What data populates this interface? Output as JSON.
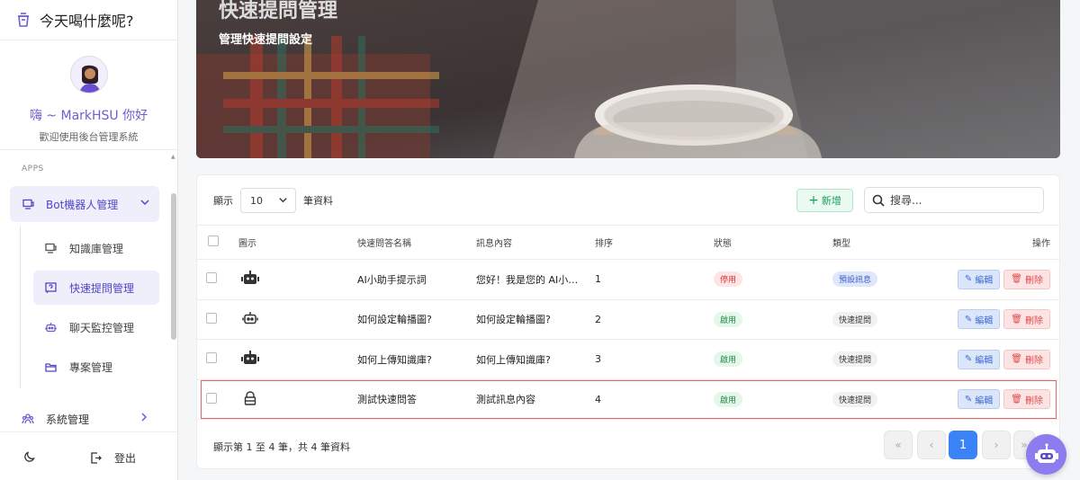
{
  "app": {
    "title": "今天喝什麼呢?"
  },
  "profile": {
    "greeting": "嗨 ~ MarkHSU 你好",
    "welcome": "歡迎使用後台管理系統"
  },
  "sidebar": {
    "section_label": "APPS",
    "group_label": "Bot機器人管理",
    "items": [
      {
        "label": "知識庫管理"
      },
      {
        "label": "快速提問管理"
      },
      {
        "label": "聊天監控管理"
      },
      {
        "label": "專案管理"
      }
    ],
    "system_label": "系統管理",
    "logout_label": "登出"
  },
  "banner": {
    "title": "快速提問管理",
    "subtitle": "管理快速提問設定"
  },
  "toolbar": {
    "show_label": "顯示",
    "page_size": "10",
    "records_label": "筆資料",
    "add_label": "新增",
    "search_placeholder": "搜尋..."
  },
  "table": {
    "headers": [
      "圖示",
      "快速問答名稱",
      "訊息內容",
      "排序",
      "狀態",
      "類型",
      "操作"
    ],
    "rows": [
      {
        "icon": "robot-icon",
        "name": "AI小助手提示詞",
        "message": "您好！我是您的 AI小…",
        "order": "1",
        "status": "停用",
        "status_color": "red",
        "type": "預設訊息",
        "type_color": "blue",
        "edit": "編輯",
        "delete": "刪除"
      },
      {
        "icon": "robot-outline-icon",
        "name": "如何設定輪播圖?",
        "message": "如何設定輪播圖?",
        "order": "2",
        "status": "啟用",
        "status_color": "green",
        "type": "快速提問",
        "type_color": "gray",
        "edit": "編輯",
        "delete": "刪除"
      },
      {
        "icon": "robot-icon",
        "name": "如何上傳知識庫?",
        "message": "如何上傳知識庫?",
        "order": "3",
        "status": "啟用",
        "status_color": "green",
        "type": "快速提問",
        "type_color": "gray",
        "edit": "編輯",
        "delete": "刪除"
      },
      {
        "icon": "lock-icon",
        "name": "測試快速問答",
        "message": "測試訊息內容",
        "order": "4",
        "status": "啟用",
        "status_color": "green",
        "type": "快速提問",
        "type_color": "gray",
        "edit": "編輯",
        "delete": "刪除"
      }
    ]
  },
  "footer": {
    "info": "顯示第 1 至 4 筆，共 4 筆資料"
  },
  "pagination": {
    "first": "«",
    "prev": "‹",
    "current": "1",
    "next": "›",
    "last": "»"
  },
  "colors": {
    "accent": "#6b5fd3",
    "primary": "#3b82f6",
    "success": "#1e9b5f",
    "danger": "#dd4b4b"
  }
}
